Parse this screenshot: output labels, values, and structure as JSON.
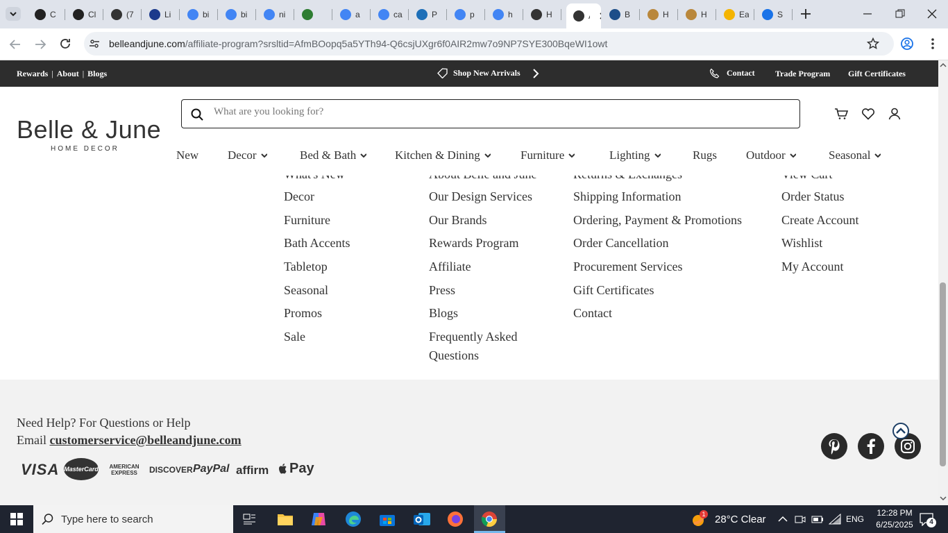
{
  "browser": {
    "tabs": [
      {
        "label": "C",
        "color": "#222"
      },
      {
        "label": "Cl",
        "color": "#222"
      },
      {
        "label": "(7",
        "color": "#333"
      },
      {
        "label": "Li",
        "color": "#1c3a8c"
      },
      {
        "label": "bi",
        "color": "#4285f4"
      },
      {
        "label": "bi",
        "color": "#4285f4"
      },
      {
        "label": "ni",
        "color": "#4285f4"
      },
      {
        "label": "",
        "color": "#2e7d32"
      },
      {
        "label": "a",
        "color": "#4285f4"
      },
      {
        "label": "ca",
        "color": "#4285f4"
      },
      {
        "label": "P",
        "color": "#1d6fb8"
      },
      {
        "label": "p",
        "color": "#4285f4"
      },
      {
        "label": "h",
        "color": "#4285f4"
      },
      {
        "label": "H",
        "color": "#333"
      },
      {
        "label": "A",
        "color": "#333"
      },
      {
        "label": "B",
        "color": "#1d4e89"
      },
      {
        "label": "H",
        "color": "#b9873b"
      },
      {
        "label": "H",
        "color": "#b9873b"
      },
      {
        "label": "Ea",
        "color": "#f4b400"
      },
      {
        "label": "S",
        "color": "#1a73e8"
      }
    ],
    "url_domain": "belleandjune.com",
    "url_path": "/affiliate-program?srsltid=AfmBOopq5a5YTh94-Q6csjUXgr6f0AIR2mw7o9NP7SYE300BqeWI1owt"
  },
  "topbar": {
    "left_links": [
      "Rewards",
      "About",
      "Blogs"
    ],
    "promo": "Shop New Arrivals",
    "contact": "Contact",
    "trade": "Trade Program",
    "gift": "Gift Certificates"
  },
  "header": {
    "logo_main": "Belle & June",
    "logo_sub": "HOME DECOR",
    "search_placeholder": "What are you looking for?",
    "nav": [
      "New",
      "Decor",
      "Bed & Bath",
      "Kitchen & Dining",
      "Furniture",
      "Lighting",
      "Rugs",
      "Outdoor",
      "Seasonal"
    ]
  },
  "footer_links": {
    "col1": [
      "What's New",
      "Decor",
      "Furniture",
      "Bath Accents",
      "Tabletop",
      "Seasonal",
      "Promos",
      "Sale"
    ],
    "col2": [
      "About Belle and June",
      "Our Design Services",
      "Our Brands",
      "Rewards Program",
      "Affiliate",
      "Press",
      "Blogs",
      "Frequently Asked",
      "Questions"
    ],
    "col3": [
      "Returns & Exchanges",
      "Shipping Information",
      "Ordering, Payment & Promotions",
      "Order Cancellation",
      "Procurement Services",
      "Gift Certificates",
      "Contact"
    ],
    "col4": [
      "View Cart",
      "Order Status",
      "Create Account",
      "Wishlist",
      "My Account"
    ]
  },
  "footer": {
    "help_line1": "Need Help? For Questions or Help",
    "email_label": "Email",
    "email": "customerservice@belleandjune.com",
    "payments": [
      "VISA",
      "MasterCard",
      "AMERICAN EXPRESS",
      "DISCOVER",
      "PayPal",
      "affirm",
      "Pay"
    ]
  },
  "taskbar": {
    "search_placeholder": "Type here to search",
    "weather": "28°C  Clear",
    "weather_badge": "1",
    "lang": "ENG",
    "time": "12:28 PM",
    "date": "6/25/2025",
    "notif_count": "4"
  }
}
